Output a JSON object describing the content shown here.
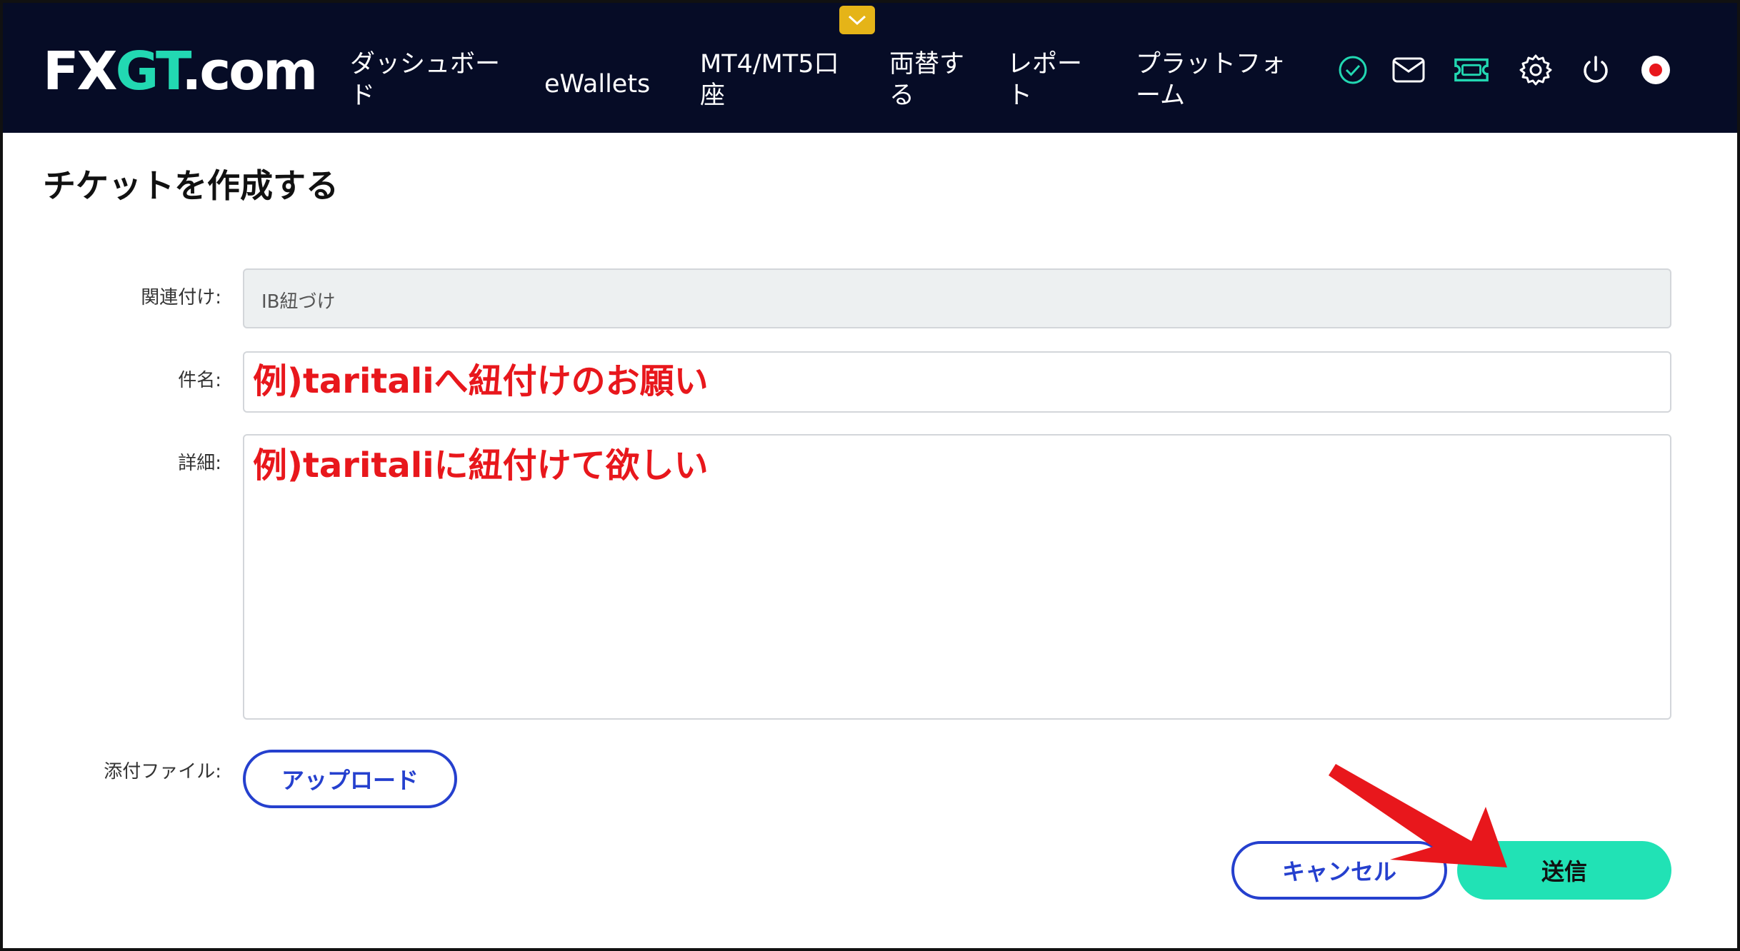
{
  "header": {
    "logo_prefix": "FX",
    "logo_g": "GT",
    "logo_suffix": ".com",
    "nav": [
      {
        "line1": "ダッシュボー",
        "line2": "ド"
      },
      {
        "line1": "eWallets",
        "line2": ""
      },
      {
        "line1": "MT4/MT5口",
        "line2": "座"
      },
      {
        "line1": "両替す",
        "line2": "る"
      },
      {
        "line1": "レポー",
        "line2": "ト"
      },
      {
        "line1": "プラットフォ",
        "line2": "ーム"
      }
    ],
    "icons": [
      "check-circle-icon",
      "mail-icon",
      "ticket-icon",
      "gear-icon",
      "power-icon",
      "japan-flag-icon"
    ],
    "accent": "#22d8b2"
  },
  "page": {
    "title": "チケットを作成する"
  },
  "form": {
    "related_label": "関連付け:",
    "related_value": "IB紐づけ",
    "subject_label": "件名:",
    "subject_value": "例)taritaliへ紐付けのお願い",
    "detail_label": "詳細:",
    "detail_value": "例)taritaliに紐付けて欲しい",
    "attachment_label": "添付ファイル:",
    "upload_label": "アップロード"
  },
  "actions": {
    "cancel_label": "キャンセル",
    "submit_label": "送信"
  },
  "colors": {
    "header_bg": "#060c26",
    "primary": "#21e2b5",
    "outline": "#2540ce",
    "annotation": "#e8171c"
  }
}
